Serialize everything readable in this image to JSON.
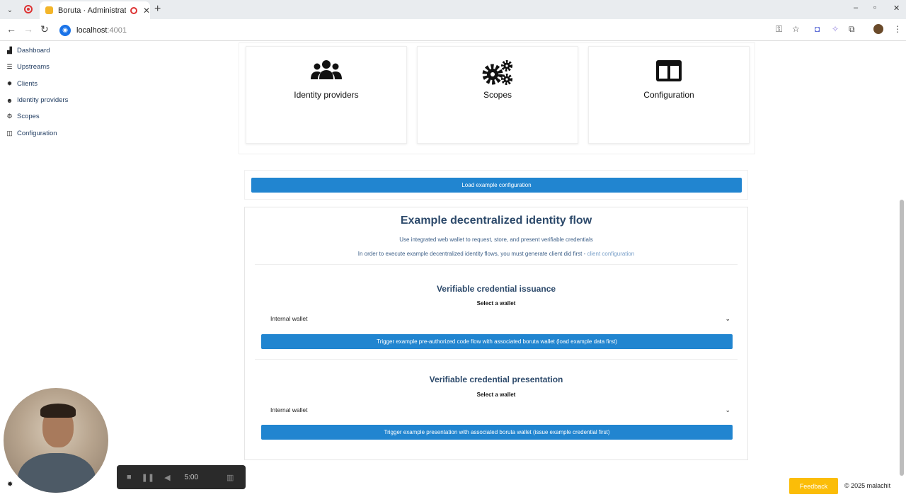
{
  "browser": {
    "tab_title": "Boruta · Administratio",
    "url_host": "localhost",
    "url_port": ":4001"
  },
  "sidebar": {
    "items": [
      {
        "label": "Dashboard",
        "icon": "chart-icon"
      },
      {
        "label": "Upstreams",
        "icon": "list-icon"
      },
      {
        "label": "Clients",
        "icon": "gear-icon"
      },
      {
        "label": "Identity providers",
        "icon": "users-icon"
      },
      {
        "label": "Scopes",
        "icon": "gears-icon"
      },
      {
        "label": "Configuration",
        "icon": "columns-icon"
      }
    ]
  },
  "cards": [
    {
      "label": "Identity providers",
      "icon": "users-icon"
    },
    {
      "label": "Scopes",
      "icon": "gears-icon"
    },
    {
      "label": "Configuration",
      "icon": "columns-icon"
    }
  ],
  "load_button": "Load example configuration",
  "flow": {
    "title": "Example decentralized identity flow",
    "subtitle": "Use integrated web wallet to request, store, and present verifiable credentials",
    "note": "In order to execute example decentralized identity flows, you must generate client did first - ",
    "note_link": "client configuration",
    "issuance": {
      "title": "Verifiable credential issuance",
      "select_label": "Select a wallet",
      "selected": "Internal wallet",
      "button": "Trigger example pre-authorized code flow with associated boruta wallet (load example data first)"
    },
    "presentation": {
      "title": "Verifiable credential presentation",
      "select_label": "Select a wallet",
      "selected": "Internal wallet",
      "button": "Trigger example presentation with associated boruta wallet (issue example credential first)"
    }
  },
  "recorder": {
    "time": "5:00"
  },
  "footer": {
    "feedback": "Feedback",
    "copyright": "© 2025 malachit"
  },
  "colors": {
    "accent": "#2185d0",
    "feedback": "#fbbd08",
    "heading": "#2d4a6b"
  }
}
